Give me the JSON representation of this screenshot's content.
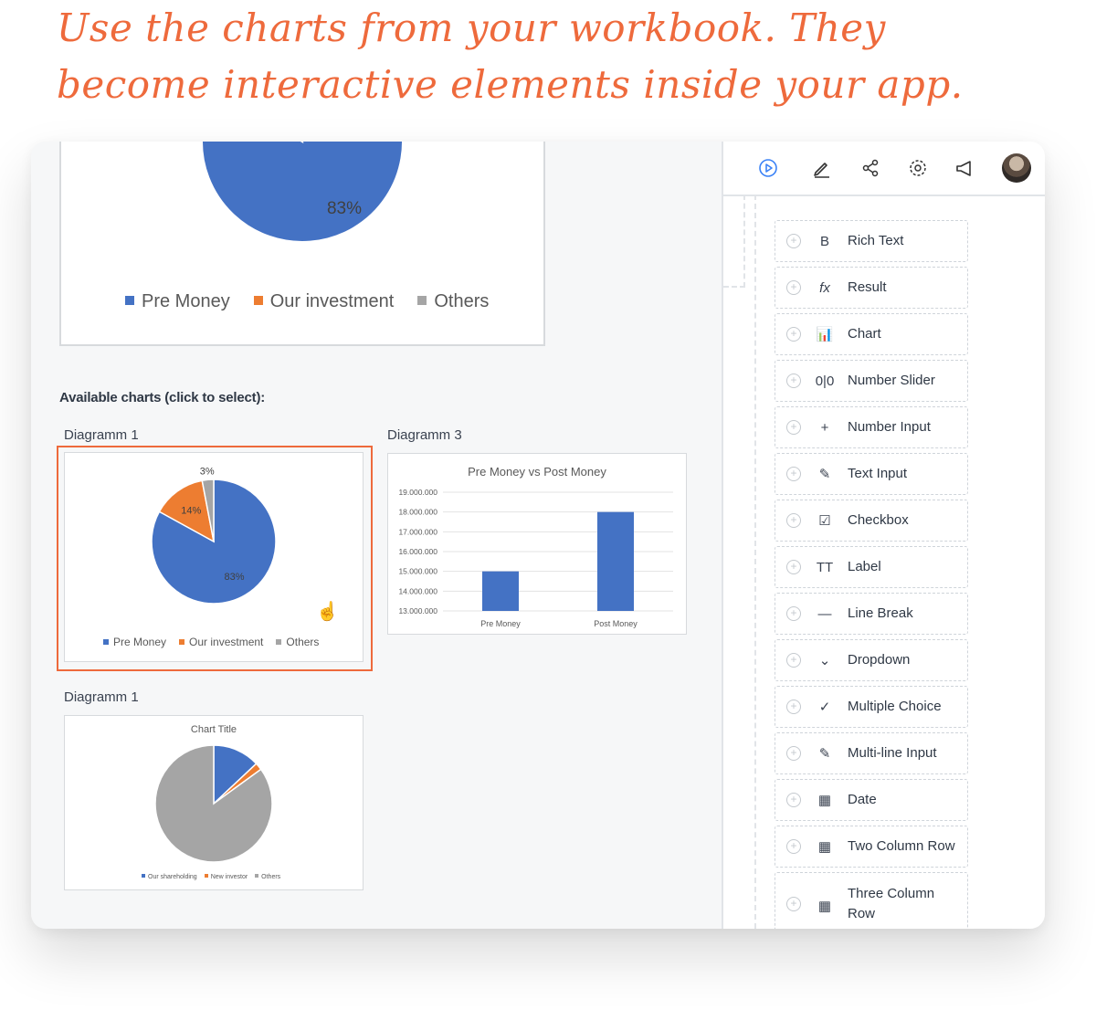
{
  "headline": {
    "line1": "Use the charts from your workbook. They",
    "line2": "become interactive elements inside your app."
  },
  "colors": {
    "accent": "#ee6a3c",
    "pre_money": "#4472c4",
    "our_investment": "#ed7d31",
    "others": "#a5a5a5"
  },
  "toolbar": {
    "icons": [
      "play-icon",
      "pencil-icon",
      "share-icon",
      "gear-icon",
      "megaphone-icon",
      "avatar"
    ]
  },
  "components": [
    {
      "icon": "bold-icon",
      "glyph": "B",
      "label": "Rich Text"
    },
    {
      "icon": "fx-icon",
      "glyph": "fx",
      "label": "Result"
    },
    {
      "icon": "chart-icon",
      "glyph": "📊",
      "label": "Chart"
    },
    {
      "icon": "slider-icon",
      "glyph": "0|0",
      "label": "Number Slider"
    },
    {
      "icon": "plus-icon",
      "glyph": "+",
      "label": "Number Input"
    },
    {
      "icon": "pencil-icon",
      "glyph": "✎",
      "label": "Text Input"
    },
    {
      "icon": "checkbox-icon",
      "glyph": "☑",
      "label": "Checkbox"
    },
    {
      "icon": "text-size-icon",
      "glyph": "TT",
      "label": "Label"
    },
    {
      "icon": "line-break-icon",
      "glyph": "—",
      "label": "Line Break"
    },
    {
      "icon": "dropdown-icon",
      "glyph": "⌄",
      "label": "Dropdown"
    },
    {
      "icon": "check-circle-icon",
      "glyph": "✓",
      "label": "Multiple Choice"
    },
    {
      "icon": "edit-box-icon",
      "glyph": "✎",
      "label": "Multi-line Input"
    },
    {
      "icon": "calendar-icon",
      "glyph": "▦",
      "label": "Date"
    },
    {
      "icon": "table-icon",
      "glyph": "▦",
      "label": "Two Column Row"
    },
    {
      "icon": "table-icon",
      "glyph": "▦",
      "label": "Three Column Row"
    }
  ],
  "main": {
    "section_title": "Available charts (click to select):",
    "diagram1_label": "Diagramm 1",
    "diagram3_label": "Diagramm 3",
    "diagram1b_label": "Diagramm 1"
  },
  "chart_data": [
    {
      "type": "pie",
      "id": "top-partial",
      "labels": [
        "Pre Money",
        "Our investment",
        "Others"
      ],
      "values": [
        83,
        14,
        3
      ],
      "data_labels": [
        "83%"
      ],
      "legend": "bottom"
    },
    {
      "type": "pie",
      "id": "diagramm-1",
      "labels": [
        "Pre Money",
        "Our investment",
        "Others"
      ],
      "values": [
        83,
        14,
        3
      ],
      "data_labels": [
        "83%",
        "14%",
        "3%"
      ],
      "legend": "bottom"
    },
    {
      "type": "bar",
      "id": "diagramm-3",
      "title": "Pre Money vs Post Money",
      "categories": [
        "Pre Money",
        "Post Money"
      ],
      "values": [
        15000000,
        18000000
      ],
      "ylim": [
        13000000,
        19000000
      ],
      "yticks": [
        "19.000.000",
        "18.000.000",
        "17.000.000",
        "16.000.000",
        "15.000.000",
        "14.000.000",
        "13.000.000"
      ],
      "grid": true
    },
    {
      "type": "pie",
      "id": "diagramm-1-b",
      "title": "Chart Title",
      "labels": [
        "Our shareholding",
        "New investor",
        "Others"
      ],
      "values": [
        13,
        2,
        85
      ],
      "legend": "bottom"
    }
  ]
}
